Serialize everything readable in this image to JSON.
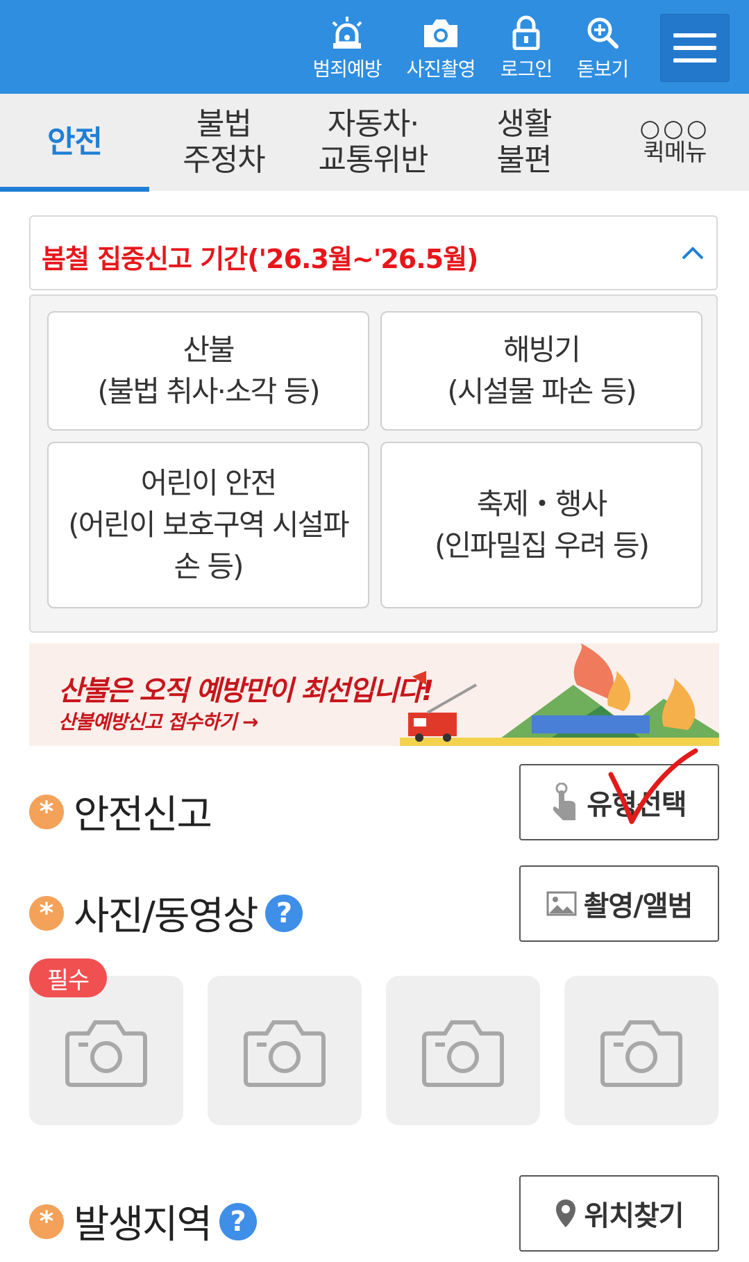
{
  "header": {
    "items": [
      {
        "label": "범죄예방",
        "icon": "siren-icon"
      },
      {
        "label": "사진촬영",
        "icon": "camera-icon"
      },
      {
        "label": "로그인",
        "icon": "lock-icon"
      },
      {
        "label": "돋보기",
        "icon": "zoom-in-icon"
      }
    ],
    "menu_icon": "hamburger-menu-icon",
    "brand_color": "#2f8ee0"
  },
  "tabs": [
    {
      "label": "안전",
      "active": true
    },
    {
      "label": "불법\n주정차",
      "active": false
    },
    {
      "label": "자동차·\n교통위반",
      "active": false
    },
    {
      "label": "생활\n불편",
      "active": false
    },
    {
      "label": "퀵메뉴",
      "active": false
    }
  ],
  "accordion": {
    "title": "봄철 집중신고 기간('26.3월~'26.5월)",
    "title_color": "#e8161b",
    "expanded": true,
    "categories": [
      {
        "line1": "산불",
        "line2": "(불법 취사·소각 등)",
        "line3": ""
      },
      {
        "line1": "해빙기",
        "line2": "(시설물 파손 등)",
        "line3": ""
      },
      {
        "line1": "어린이 안전",
        "line2": "(어린이 보호구역 시설파",
        "line3": "손 등)"
      },
      {
        "line1": "축제・행사",
        "line2": "(인파밀집 우려 등)",
        "line3": ""
      }
    ]
  },
  "banner": {
    "title": "산불은 오직 예방만이 최선입니다!",
    "subtitle": "산불예방신고 접수하기 →"
  },
  "form": {
    "safety_report": {
      "label": "안전신고",
      "button": "유형선택"
    },
    "media": {
      "label": "사진/동영상",
      "button": "촬영/앨범",
      "required_badge": "필수"
    },
    "location": {
      "label": "발생지역",
      "button": "위치찾기"
    },
    "asterisk": "*",
    "help": "?"
  }
}
